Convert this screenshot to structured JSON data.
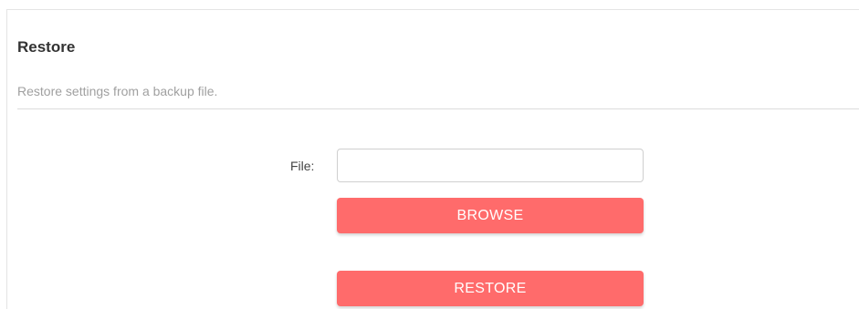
{
  "section": {
    "title": "Restore",
    "description": "Restore settings from a backup file."
  },
  "form": {
    "file_label": "File:",
    "file_value": "",
    "browse_label": "BROWSE",
    "restore_label": "RESTORE"
  },
  "colors": {
    "accent": "#ff6b6b",
    "title_text": "#333333",
    "description_text": "#a0a0a0",
    "divider": "#dcdcdc"
  }
}
